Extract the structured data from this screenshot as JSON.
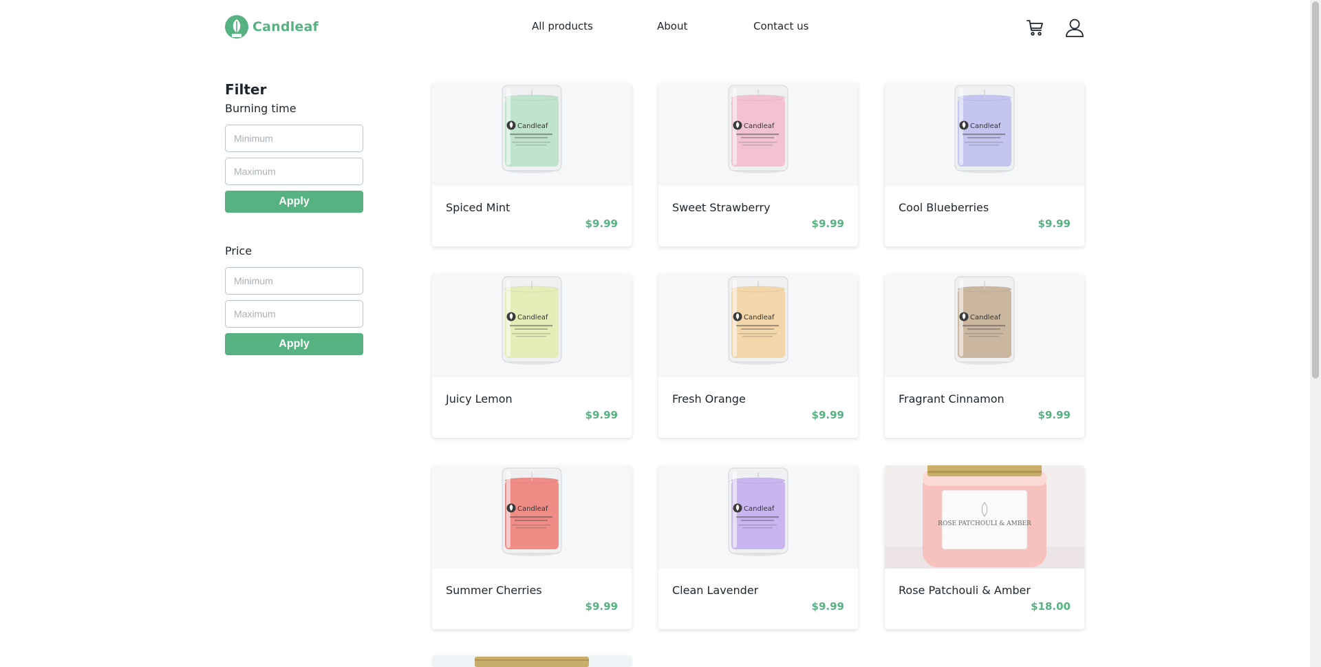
{
  "brand": {
    "name": "Candleaf",
    "accent": "#56b280"
  },
  "nav": {
    "items": [
      "All products",
      "About",
      "Contact us"
    ]
  },
  "header_icons": {
    "cart": "cart-icon",
    "account": "user-icon"
  },
  "filter": {
    "title": "Filter",
    "burning_time": {
      "label": "Burning time",
      "min_placeholder": "Minimum",
      "max_placeholder": "Maximum",
      "apply_label": "Apply"
    },
    "price": {
      "label": "Price",
      "min_placeholder": "Minimum",
      "max_placeholder": "Maximum",
      "apply_label": "Apply"
    }
  },
  "products": [
    {
      "name": "Spiced Mint",
      "price": "$9.99",
      "wax_color": "#bfe4cb",
      "label": "Candleaf"
    },
    {
      "name": "Sweet Strawberry",
      "price": "$9.99",
      "wax_color": "#f2c2d3",
      "label": "Candleaf"
    },
    {
      "name": "Cool Blueberries",
      "price": "$9.99",
      "wax_color": "#c3c4f0",
      "label": "Candleaf"
    },
    {
      "name": "Juicy Lemon",
      "price": "$9.99",
      "wax_color": "#e4eeb8",
      "label": "Candleaf"
    },
    {
      "name": "Fresh Orange",
      "price": "$9.99",
      "wax_color": "#f3d6a9",
      "label": "Candleaf"
    },
    {
      "name": "Fragrant Cinnamon",
      "price": "$9.99",
      "wax_color": "#cbb69f",
      "label": "Candleaf"
    },
    {
      "name": "Summer Cherries",
      "price": "$9.99",
      "wax_color": "#f08c86",
      "label": "Candleaf"
    },
    {
      "name": "Clean Lavender",
      "price": "$9.99",
      "wax_color": "#c9b5ef",
      "label": "Candleaf"
    },
    {
      "name": "Rose Patchouli & Amber",
      "price": "$18.00",
      "wax_color": "#f7c1bd",
      "label": "ROSE PATCHOULI & AMBER"
    }
  ]
}
